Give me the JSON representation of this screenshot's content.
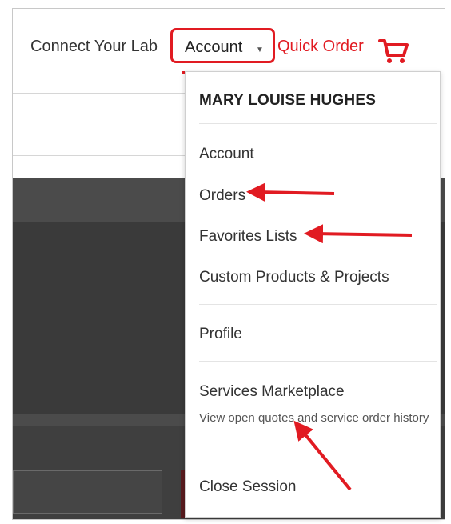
{
  "nav": {
    "connect_label": "Connect Your Lab",
    "account_label": "Account",
    "quick_order_label": "Quick Order"
  },
  "menu": {
    "user_name": "MARY LOUISE HUGHES",
    "items": [
      {
        "label": "Account"
      },
      {
        "label": "Orders"
      },
      {
        "label": "Favorites Lists"
      },
      {
        "label": "Custom Products & Projects"
      },
      {
        "label": "Profile"
      },
      {
        "label": "Services Marketplace"
      },
      {
        "label": "Close Session"
      }
    ],
    "services_subtext": "View open quotes and service order history"
  },
  "icons": {
    "cart": "shopping-cart-icon",
    "caret": "caret-down-icon",
    "annotation_arrow": "red-arrow-icon"
  },
  "colors": {
    "brand_red": "#e11b22",
    "dark_band": "#4b4b4b"
  }
}
